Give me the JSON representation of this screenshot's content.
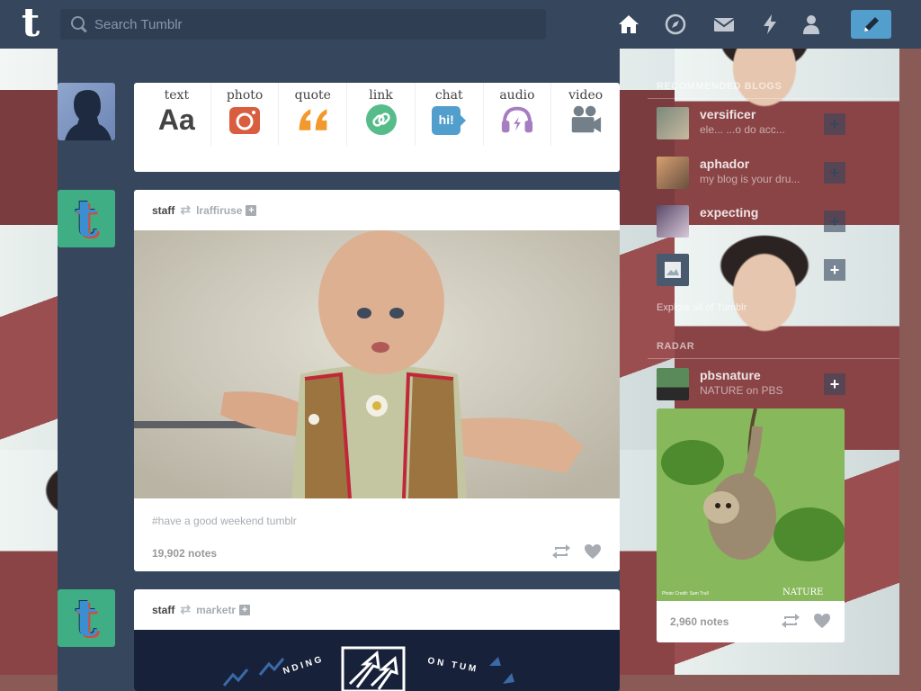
{
  "topbar": {
    "logo": "t",
    "search_placeholder": "Search Tumblr",
    "icons": [
      "home-icon",
      "explore-icon",
      "messages-icon",
      "activity-icon",
      "account-icon",
      "compose-icon"
    ]
  },
  "post_types": [
    {
      "label": "text",
      "icon_text": "Aa",
      "color": "#444444"
    },
    {
      "label": "photo",
      "icon_text": "",
      "color": "#d95e40"
    },
    {
      "label": "quote",
      "icon_text": "❝",
      "color": "#f2992e"
    },
    {
      "label": "link",
      "icon_text": "",
      "color": "#56bc8a"
    },
    {
      "label": "chat",
      "icon_text": "hi!",
      "color": "#529ecc"
    },
    {
      "label": "audio",
      "icon_text": "",
      "color": "#a77dc2"
    },
    {
      "label": "video",
      "icon_text": "",
      "color": "#748089"
    }
  ],
  "posts": [
    {
      "author": "staff",
      "reblogged_from": "lraffiruse",
      "tags": "#have a good weekend tumblr",
      "notes": "19,902 notes"
    },
    {
      "author": "staff",
      "reblogged_from": "marketr",
      "banner_text_left": "NDING",
      "banner_text_right": "ON TUM"
    }
  ],
  "sidebar": {
    "recommended_title": "Recommended Blogs",
    "recommended": [
      {
        "name": "versificer",
        "desc": "ele... ...o do acc..."
      },
      {
        "name": "aphador",
        "desc": "my blog is your dru..."
      },
      {
        "name": "expecting",
        "desc": ""
      },
      {
        "name": "",
        "desc": ""
      }
    ],
    "explore_text": "Explore all of Tumblr",
    "radar_title": "Radar",
    "radar": {
      "name": "pbsnature",
      "desc": "NATURE on PBS",
      "notes": "2,960 notes",
      "photo_credit": "Photo Credit: Sam Trull",
      "watermark": "NATURE"
    }
  },
  "colors": {
    "nav_bg": "#36465d",
    "accent": "#529ecc"
  }
}
